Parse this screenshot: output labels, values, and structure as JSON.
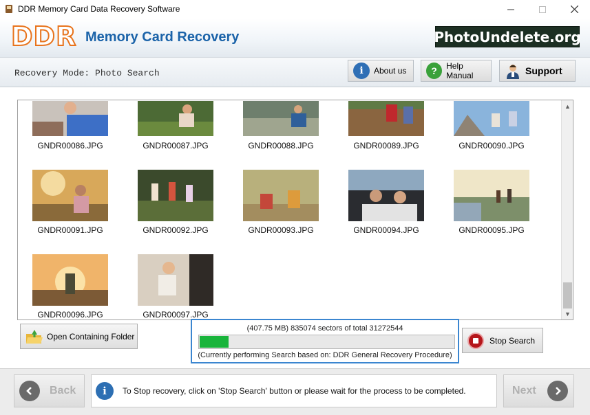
{
  "window": {
    "title": "DDR Memory Card Data Recovery Software",
    "minimize_icon": "minimize-icon",
    "maximize_icon": "maximize-icon",
    "close_icon": "close-icon"
  },
  "banner": {
    "logo": "DDR",
    "product": "Memory Card Recovery",
    "brand": "PhotoUndelete.org",
    "logo_color": "#e8731c",
    "product_color": "#1b63a9"
  },
  "toolbar": {
    "mode_text": "Recovery Mode: Photo Search",
    "about_label": "About us",
    "help_label": "Help Manual",
    "support_label": "Support"
  },
  "gallery": {
    "files": [
      "GNDR00086.JPG",
      "GNDR00087.JPG",
      "GNDR00088.JPG",
      "GNDR00089.JPG",
      "GNDR00090.JPG",
      "GNDR00091.JPG",
      "GNDR00092.JPG",
      "GNDR00093.JPG",
      "GNDR00094.JPG",
      "GNDR00095.JPG",
      "GNDR00096.JPG",
      "GNDR00097.JPG"
    ]
  },
  "actions": {
    "open_folder_label": "Open Containing Folder",
    "stop_search_label": "Stop Search"
  },
  "progress": {
    "line1": "(407.75 MB) 835074  sectors  of  total 31272544",
    "line2": "(Currently performing Search based on:  DDR General Recovery Procedure)",
    "sectors_done": 835074,
    "sectors_total": 31272544,
    "bar_fraction": 0.115,
    "fill_color": "#19b43b"
  },
  "footer": {
    "back_label": "Back",
    "next_label": "Next",
    "hint": "To Stop recovery, click on 'Stop Search' button or please wait for the process to be completed."
  }
}
